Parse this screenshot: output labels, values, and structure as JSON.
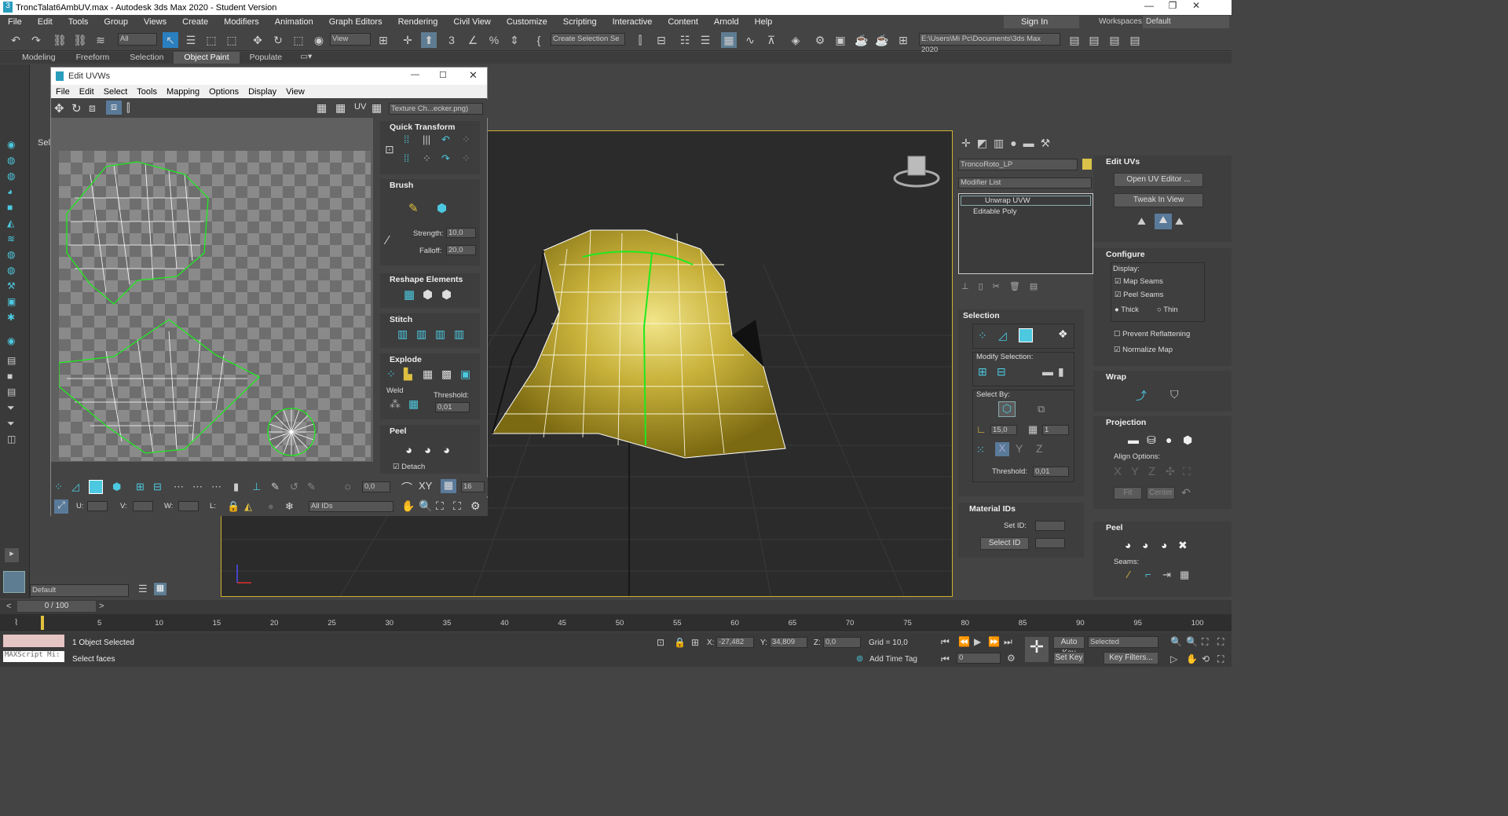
{
  "window": {
    "title": "TroncTalat6AmbUV.max - Autodesk 3ds Max 2020 - Student Version"
  },
  "menu": [
    "File",
    "Edit",
    "Tools",
    "Group",
    "Views",
    "Create",
    "Modifiers",
    "Animation",
    "Graph Editors",
    "Rendering",
    "Civil View",
    "Customize",
    "Scripting",
    "Interactive",
    "Content",
    "Arnold",
    "Help"
  ],
  "account": {
    "sign_in": "Sign In",
    "workspaces_label": "Workspaces:",
    "workspace": "Default"
  },
  "toolbar": {
    "filter": "All",
    "view": "View",
    "selection_set": "Create Selection Se",
    "path": "E:\\Users\\Mi Pc\\Documents\\3ds Max 2020"
  },
  "ribbon": {
    "tabs": [
      "Modeling",
      "Freeform",
      "Selection",
      "Object Paint",
      "Populate"
    ],
    "active": "Object Paint"
  },
  "left_panel": {
    "label": "Sele",
    "layer": "Default"
  },
  "uv_editor": {
    "title": "Edit UVWs",
    "menu": [
      "File",
      "Edit",
      "Select",
      "Tools",
      "Mapping",
      "Options",
      "Display",
      "View"
    ],
    "uv_label": "UV",
    "texture": "Texture Ch...ecker.png)",
    "quick_transform": "Quick Transform",
    "brush": "Brush",
    "strength_label": "Strength:",
    "strength": "10,0",
    "falloff_label": "Falloff:",
    "falloff": "20,0",
    "reshape": "Reshape Elements",
    "stitch": "Stitch",
    "explode": "Explode",
    "weld": "Weld",
    "threshold_label": "Threshold:",
    "threshold": "0,01",
    "peel": "Peel",
    "detach": "Detach",
    "spin_value": "0,0",
    "xy": "XY",
    "count": "16",
    "u_label": "U:",
    "v_label": "V:",
    "w_label": "W:",
    "l_label": "L:",
    "ids": "All IDs"
  },
  "command_panel": {
    "object_name": "TroncoRoto_LP",
    "modifier_list": "Modifier List",
    "stack": [
      "Unwrap UVW",
      "Editable Poly"
    ],
    "selection": {
      "title": "Selection",
      "modify_selection": "Modify Selection:",
      "select_by": "Select By:",
      "angle": "15,0",
      "count": "1",
      "threshold_label": "Threshold:",
      "threshold": "0,01"
    },
    "material_ids": {
      "title": "Material IDs",
      "set_id": "Set ID:",
      "select_id": "Select ID"
    },
    "edit_uvs": {
      "title": "Edit UVs",
      "open_editor": "Open UV Editor ...",
      "tweak": "Tweak In View"
    },
    "configure": {
      "title": "Configure",
      "display": "Display:",
      "map_seams": "Map Seams",
      "peel_seams": "Peel Seams",
      "thick": "Thick",
      "thin": "Thin",
      "prevent_reflattening": "Prevent Reflattening",
      "normalize_map": "Normalize Map"
    },
    "wrap": "Wrap",
    "projection": {
      "title": "Projection",
      "align_options": "Align Options:",
      "fit": "Fit",
      "center": "Center"
    },
    "peel": {
      "title": "Peel",
      "seams": "Seams:"
    }
  },
  "timeline": {
    "frame": "0 / 100",
    "ticks": [
      "5",
      "10",
      "15",
      "20",
      "25",
      "30",
      "35",
      "40",
      "45",
      "50",
      "55",
      "60",
      "65",
      "70",
      "75",
      "80",
      "85",
      "90",
      "95",
      "100"
    ]
  },
  "status": {
    "maxscript": "MAXScript Mi:",
    "selected": "1 Object Selected",
    "prompt": "Select faces",
    "x_label": "X:",
    "x": "-27,482",
    "y_label": "Y:",
    "y": "34,809",
    "z_label": "Z:",
    "z": "0,0",
    "grid": "Grid = 10,0",
    "add_time_tag": "Add Time Tag",
    "auto_key": "Auto Key",
    "selected_dropdown": "Selected",
    "set_key": "Set Key",
    "key_filters": "Key Filters...",
    "frame_field": "0"
  }
}
